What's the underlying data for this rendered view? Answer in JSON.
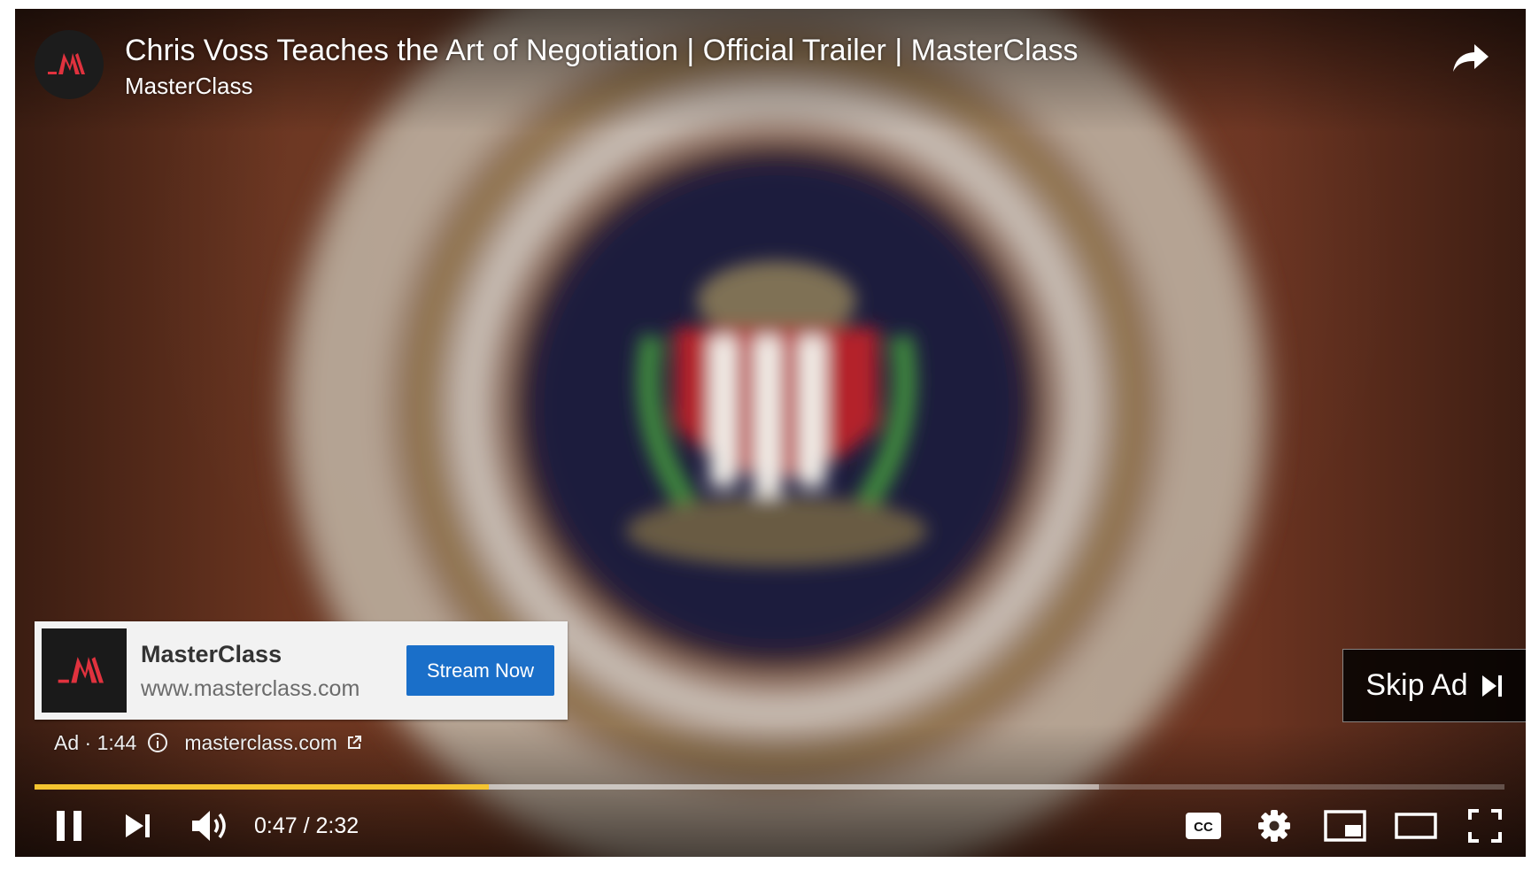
{
  "video": {
    "title": "Chris Voss Teaches the Art of Negotiation | Official Trailer | MasterClass",
    "channel": "MasterClass",
    "share_icon": "share-arrow-icon",
    "channel_logo_icon": "masterclass-logo-icon"
  },
  "ad": {
    "advertiser": "MasterClass",
    "display_url": "www.masterclass.com",
    "cta_label": "Stream Now",
    "ad_label": "Ad · 1:44",
    "domain_link": "masterclass.com",
    "skip_label": "Skip Ad"
  },
  "playback": {
    "current_time": "0:47",
    "separator": " / ",
    "duration": "2:32",
    "played_fraction": 0.309,
    "buffered_fraction": 0.724
  },
  "controls": {
    "icons": [
      "pause-icon",
      "next-icon",
      "volume-icon",
      "captions-icon",
      "settings-icon",
      "miniplayer-icon",
      "theater-mode-icon",
      "fullscreen-icon"
    ]
  },
  "colors": {
    "progress": "#f4c430",
    "cta_button": "#1a6fc9",
    "brand_red": "#e0323e"
  }
}
